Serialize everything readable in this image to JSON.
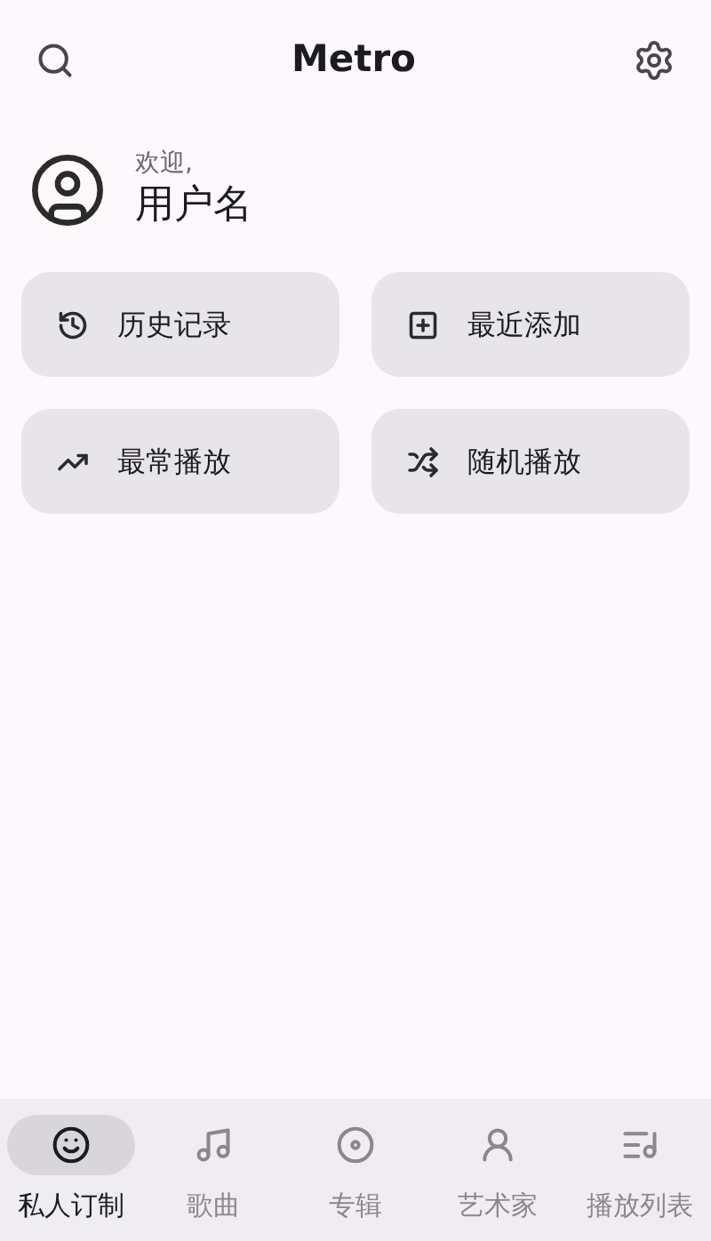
{
  "app_bar": {
    "title": "Metro"
  },
  "user": {
    "greeting": "欢迎,",
    "name": "用户名"
  },
  "shortcuts": [
    {
      "kind": "history",
      "label": "历史记录"
    },
    {
      "kind": "recent",
      "label": "最近添加"
    },
    {
      "kind": "top",
      "label": "最常播放"
    },
    {
      "kind": "shuffle",
      "label": "随机播放"
    }
  ],
  "nav": [
    {
      "kind": "personal",
      "label": "私人订制",
      "selected": true
    },
    {
      "kind": "songs",
      "label": "歌曲",
      "selected": false
    },
    {
      "kind": "albums",
      "label": "专辑",
      "selected": false
    },
    {
      "kind": "artists",
      "label": "艺术家",
      "selected": false
    },
    {
      "kind": "playlists",
      "label": "播放列表",
      "selected": false
    }
  ]
}
